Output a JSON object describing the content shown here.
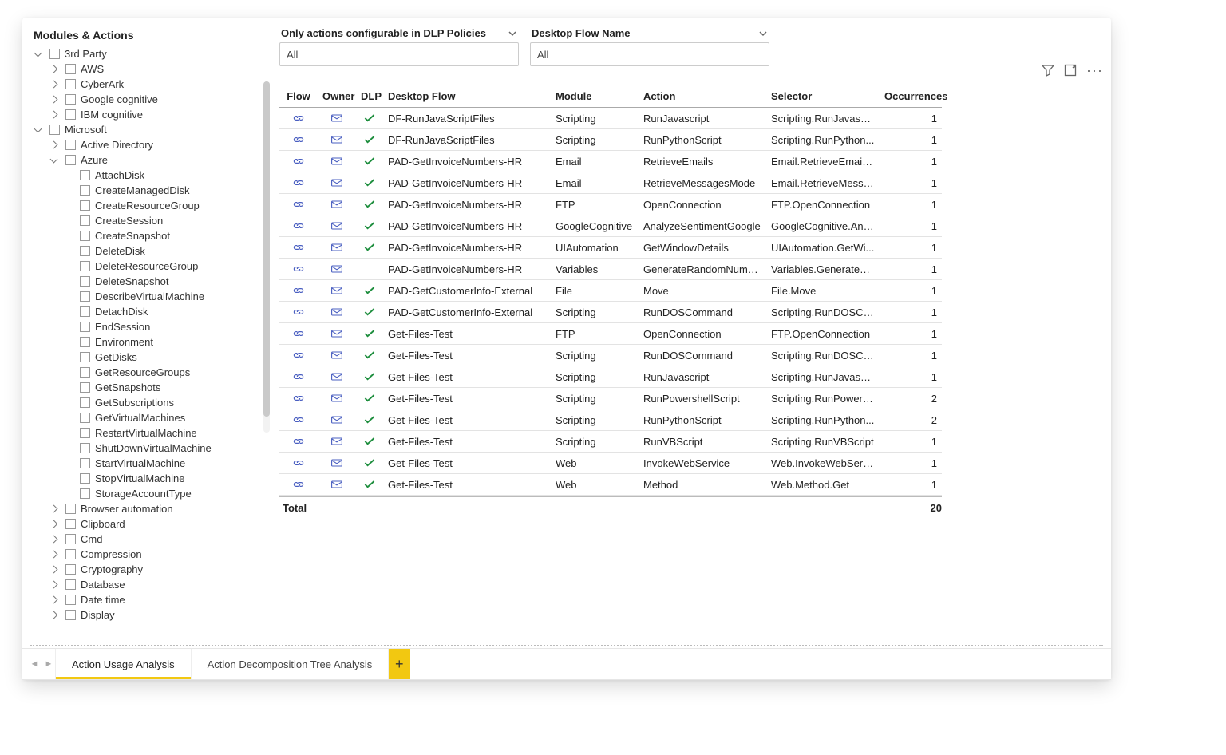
{
  "left": {
    "title": "Modules & Actions",
    "tree": [
      {
        "depth": 0,
        "expand": "open",
        "check": true,
        "label": "3rd Party"
      },
      {
        "depth": 1,
        "expand": "closed",
        "check": true,
        "label": "AWS"
      },
      {
        "depth": 1,
        "expand": "closed",
        "check": true,
        "label": "CyberArk"
      },
      {
        "depth": 1,
        "expand": "closed",
        "check": true,
        "label": "Google cognitive"
      },
      {
        "depth": 1,
        "expand": "closed",
        "check": true,
        "label": "IBM cognitive"
      },
      {
        "depth": 0,
        "expand": "open",
        "check": true,
        "label": "Microsoft"
      },
      {
        "depth": 1,
        "expand": "closed",
        "check": true,
        "label": "Active Directory"
      },
      {
        "depth": 1,
        "expand": "open",
        "check": true,
        "label": "Azure"
      },
      {
        "depth": 2,
        "expand": "none",
        "check": true,
        "label": "AttachDisk"
      },
      {
        "depth": 2,
        "expand": "none",
        "check": true,
        "label": "CreateManagedDisk"
      },
      {
        "depth": 2,
        "expand": "none",
        "check": true,
        "label": "CreateResourceGroup"
      },
      {
        "depth": 2,
        "expand": "none",
        "check": true,
        "label": "CreateSession"
      },
      {
        "depth": 2,
        "expand": "none",
        "check": true,
        "label": "CreateSnapshot"
      },
      {
        "depth": 2,
        "expand": "none",
        "check": true,
        "label": "DeleteDisk"
      },
      {
        "depth": 2,
        "expand": "none",
        "check": true,
        "label": "DeleteResourceGroup"
      },
      {
        "depth": 2,
        "expand": "none",
        "check": true,
        "label": "DeleteSnapshot"
      },
      {
        "depth": 2,
        "expand": "none",
        "check": true,
        "label": "DescribeVirtualMachine"
      },
      {
        "depth": 2,
        "expand": "none",
        "check": true,
        "label": "DetachDisk"
      },
      {
        "depth": 2,
        "expand": "none",
        "check": true,
        "label": "EndSession"
      },
      {
        "depth": 2,
        "expand": "none",
        "check": true,
        "label": "Environment"
      },
      {
        "depth": 2,
        "expand": "none",
        "check": true,
        "label": "GetDisks"
      },
      {
        "depth": 2,
        "expand": "none",
        "check": true,
        "label": "GetResourceGroups"
      },
      {
        "depth": 2,
        "expand": "none",
        "check": true,
        "label": "GetSnapshots"
      },
      {
        "depth": 2,
        "expand": "none",
        "check": true,
        "label": "GetSubscriptions"
      },
      {
        "depth": 2,
        "expand": "none",
        "check": true,
        "label": "GetVirtualMachines"
      },
      {
        "depth": 2,
        "expand": "none",
        "check": true,
        "label": "RestartVirtualMachine"
      },
      {
        "depth": 2,
        "expand": "none",
        "check": true,
        "label": "ShutDownVirtualMachine"
      },
      {
        "depth": 2,
        "expand": "none",
        "check": true,
        "label": "StartVirtualMachine"
      },
      {
        "depth": 2,
        "expand": "none",
        "check": true,
        "label": "StopVirtualMachine"
      },
      {
        "depth": 2,
        "expand": "none",
        "check": true,
        "label": "StorageAccountType"
      },
      {
        "depth": 1,
        "expand": "closed",
        "check": true,
        "label": "Browser automation"
      },
      {
        "depth": 1,
        "expand": "closed",
        "check": true,
        "label": "Clipboard"
      },
      {
        "depth": 1,
        "expand": "closed",
        "check": true,
        "label": "Cmd"
      },
      {
        "depth": 1,
        "expand": "closed",
        "check": true,
        "label": "Compression"
      },
      {
        "depth": 1,
        "expand": "closed",
        "check": true,
        "label": "Cryptography"
      },
      {
        "depth": 1,
        "expand": "closed",
        "check": true,
        "label": "Database"
      },
      {
        "depth": 1,
        "expand": "closed",
        "check": true,
        "label": "Date time"
      },
      {
        "depth": 1,
        "expand": "closed",
        "check": true,
        "label": "Display"
      }
    ]
  },
  "slicers": {
    "dlp": {
      "title": "Only actions configurable in DLP Policies",
      "value": "All"
    },
    "flow": {
      "title": "Desktop Flow Name",
      "value": "All"
    }
  },
  "table": {
    "headers": {
      "flow": "Flow",
      "owner": "Owner",
      "dlp": "DLP",
      "name": "Desktop Flow",
      "module": "Module",
      "action": "Action",
      "selector": "Selector",
      "occ": "Occurrences"
    },
    "rows": [
      {
        "dlp": true,
        "name": "DF-RunJavaScriptFiles",
        "module": "Scripting",
        "action": "RunJavascript",
        "selector": "Scripting.RunJavascript",
        "occ": 1
      },
      {
        "dlp": true,
        "name": "DF-RunJavaScriptFiles",
        "module": "Scripting",
        "action": "RunPythonScript",
        "selector": "Scripting.RunPython...",
        "occ": 1
      },
      {
        "dlp": true,
        "name": "PAD-GetInvoiceNumbers-HR",
        "module": "Email",
        "action": "RetrieveEmails",
        "selector": "Email.RetrieveEmails....",
        "occ": 1
      },
      {
        "dlp": true,
        "name": "PAD-GetInvoiceNumbers-HR",
        "module": "Email",
        "action": "RetrieveMessagesMode",
        "selector": "Email.RetrieveMessa...",
        "occ": 1
      },
      {
        "dlp": true,
        "name": "PAD-GetInvoiceNumbers-HR",
        "module": "FTP",
        "action": "OpenConnection",
        "selector": "FTP.OpenConnection",
        "occ": 1
      },
      {
        "dlp": true,
        "name": "PAD-GetInvoiceNumbers-HR",
        "module": "GoogleCognitive",
        "action": "AnalyzeSentimentGoogle",
        "selector": "GoogleCognitive.Ana...",
        "occ": 1
      },
      {
        "dlp": true,
        "name": "PAD-GetInvoiceNumbers-HR",
        "module": "UIAutomation",
        "action": "GetWindowDetails",
        "selector": "UIAutomation.GetWi...",
        "occ": 1
      },
      {
        "dlp": false,
        "name": "PAD-GetInvoiceNumbers-HR",
        "module": "Variables",
        "action": "GenerateRandomNumber",
        "selector": "Variables.GenerateRa...",
        "occ": 1
      },
      {
        "dlp": true,
        "name": "PAD-GetCustomerInfo-External",
        "module": "File",
        "action": "Move",
        "selector": "File.Move",
        "occ": 1
      },
      {
        "dlp": true,
        "name": "PAD-GetCustomerInfo-External",
        "module": "Scripting",
        "action": "RunDOSCommand",
        "selector": "Scripting.RunDOSCo...",
        "occ": 1
      },
      {
        "dlp": true,
        "name": "Get-Files-Test",
        "module": "FTP",
        "action": "OpenConnection",
        "selector": "FTP.OpenConnection",
        "occ": 1
      },
      {
        "dlp": true,
        "name": "Get-Files-Test",
        "module": "Scripting",
        "action": "RunDOSCommand",
        "selector": "Scripting.RunDOSCo...",
        "occ": 1
      },
      {
        "dlp": true,
        "name": "Get-Files-Test",
        "module": "Scripting",
        "action": "RunJavascript",
        "selector": "Scripting.RunJavascript",
        "occ": 1
      },
      {
        "dlp": true,
        "name": "Get-Files-Test",
        "module": "Scripting",
        "action": "RunPowershellScript",
        "selector": "Scripting.RunPowers...",
        "occ": 2
      },
      {
        "dlp": true,
        "name": "Get-Files-Test",
        "module": "Scripting",
        "action": "RunPythonScript",
        "selector": "Scripting.RunPython...",
        "occ": 2
      },
      {
        "dlp": true,
        "name": "Get-Files-Test",
        "module": "Scripting",
        "action": "RunVBScript",
        "selector": "Scripting.RunVBScript",
        "occ": 1
      },
      {
        "dlp": true,
        "name": "Get-Files-Test",
        "module": "Web",
        "action": "InvokeWebService",
        "selector": "Web.InvokeWebServi...",
        "occ": 1
      },
      {
        "dlp": true,
        "name": "Get-Files-Test",
        "module": "Web",
        "action": "Method",
        "selector": "Web.Method.Get",
        "occ": 1
      }
    ],
    "footer": {
      "label": "Total",
      "total": 20
    }
  },
  "tabs": {
    "items": [
      {
        "label": "Action Usage Analysis",
        "active": true
      },
      {
        "label": "Action Decomposition Tree Analysis",
        "active": false
      }
    ],
    "add": "+"
  }
}
